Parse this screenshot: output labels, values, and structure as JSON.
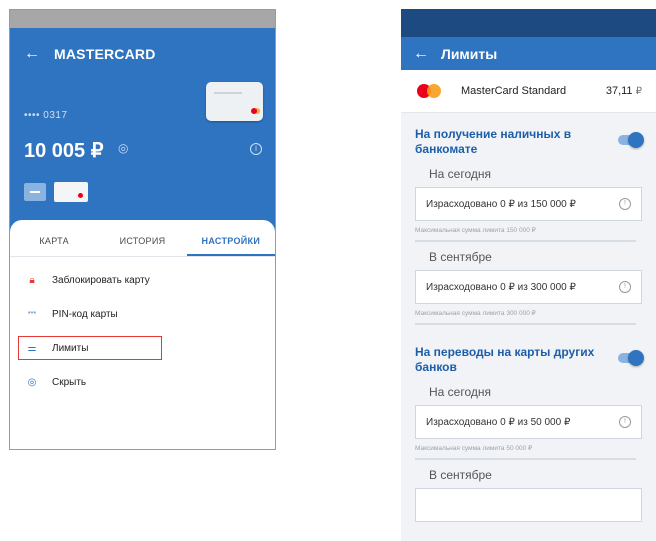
{
  "left": {
    "title": "MASTERCARD",
    "card_number": "•••• 0317",
    "balance": "10 005 ₽",
    "tabs": [
      "КАРТА",
      "ИСТОРИЯ",
      "НАСТРОЙКИ"
    ],
    "active_tab": "НАСТРОЙКИ",
    "menu": [
      {
        "label": "Заблокировать карту",
        "icon": "lock-icon"
      },
      {
        "label": "PIN-код карты",
        "icon": "pin-icon"
      },
      {
        "label": "Лимиты",
        "icon": "sliders-icon"
      },
      {
        "label": "Скрыть",
        "icon": "eye-icon"
      }
    ]
  },
  "right": {
    "title": "Лимиты",
    "card_name": "MasterCard Standard",
    "card_amount": "37,11",
    "currency": "₽",
    "sections": [
      {
        "title": "На получение наличных в банкомате",
        "periods": [
          {
            "label": "На сегодня",
            "spent": "Израсходовано 0 ₽ из 150 000 ₽",
            "hint": "Максимальная сумма лимита 150 000 ₽"
          },
          {
            "label": "В сентябре",
            "spent": "Израсходовано 0 ₽ из 300 000 ₽",
            "hint": "Максимальная сумма лимита 300 000 ₽"
          }
        ]
      },
      {
        "title": "На переводы на карты других банков",
        "periods": [
          {
            "label": "На сегодня",
            "spent": "Израсходовано 0 ₽ из 50 000 ₽",
            "hint": "Максимальная сумма лимита 50 000 ₽"
          },
          {
            "label": "В сентябре"
          }
        ]
      }
    ]
  },
  "colors": {
    "primary": "#2f74c0",
    "status_bar": "#1e4a82",
    "highlight": "#e53935",
    "title_blue": "#1d5ea9"
  }
}
